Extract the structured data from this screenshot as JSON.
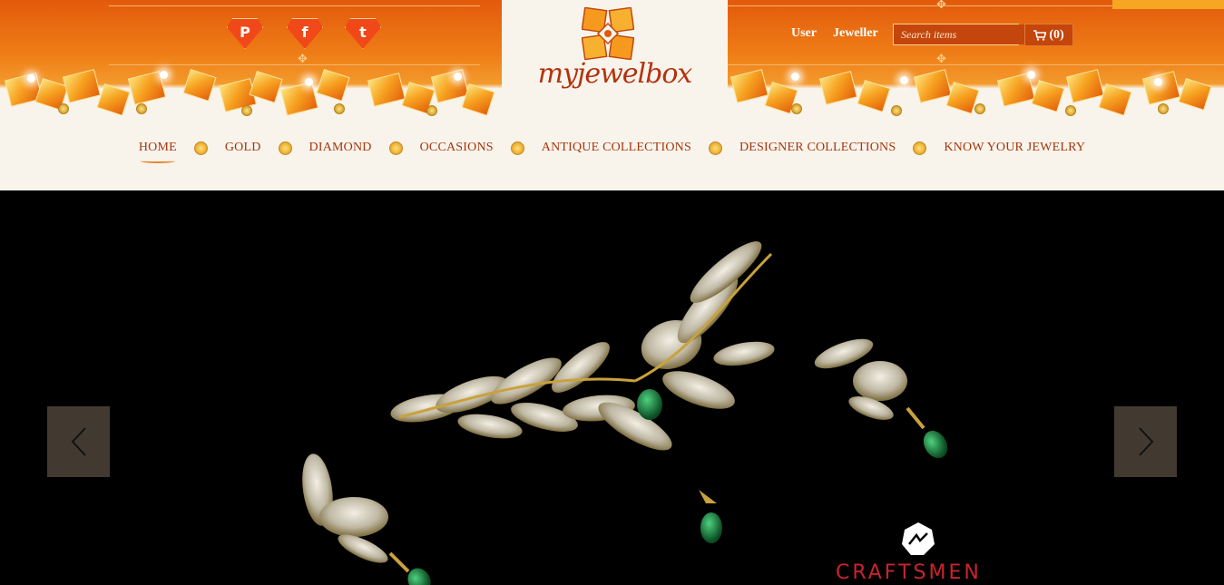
{
  "brand": {
    "name": "myjewelbox"
  },
  "social": {
    "pinterest_glyph": "P",
    "facebook_glyph": "f",
    "twitter_glyph": "t"
  },
  "account": {
    "user_label": "User",
    "jeweller_label": "Jeweller"
  },
  "search": {
    "placeholder": "Search items"
  },
  "cart": {
    "count_label": "(0)"
  },
  "nav": {
    "items": [
      {
        "label": "HOME"
      },
      {
        "label": "GOLD"
      },
      {
        "label": "DIAMOND"
      },
      {
        "label": "OCCASIONS"
      },
      {
        "label": "ANTIQUE COLLECTIONS"
      },
      {
        "label": "DESIGNER COLLECTIONS"
      },
      {
        "label": "KNOW YOUR JEWELRY"
      }
    ],
    "active": "HOME"
  },
  "hero": {
    "watermark": "CRAFTSMEN"
  },
  "colors": {
    "accent": "#a8360c",
    "banner": "#ef7d16",
    "cart_bg": "#c4460c",
    "search_button": "#f6a623",
    "watermark": "#c8242d"
  },
  "icons": [
    "pinterest-icon",
    "facebook-icon",
    "twitter-icon",
    "search-icon",
    "cart-icon",
    "chevron-left-icon",
    "chevron-right-icon"
  ]
}
